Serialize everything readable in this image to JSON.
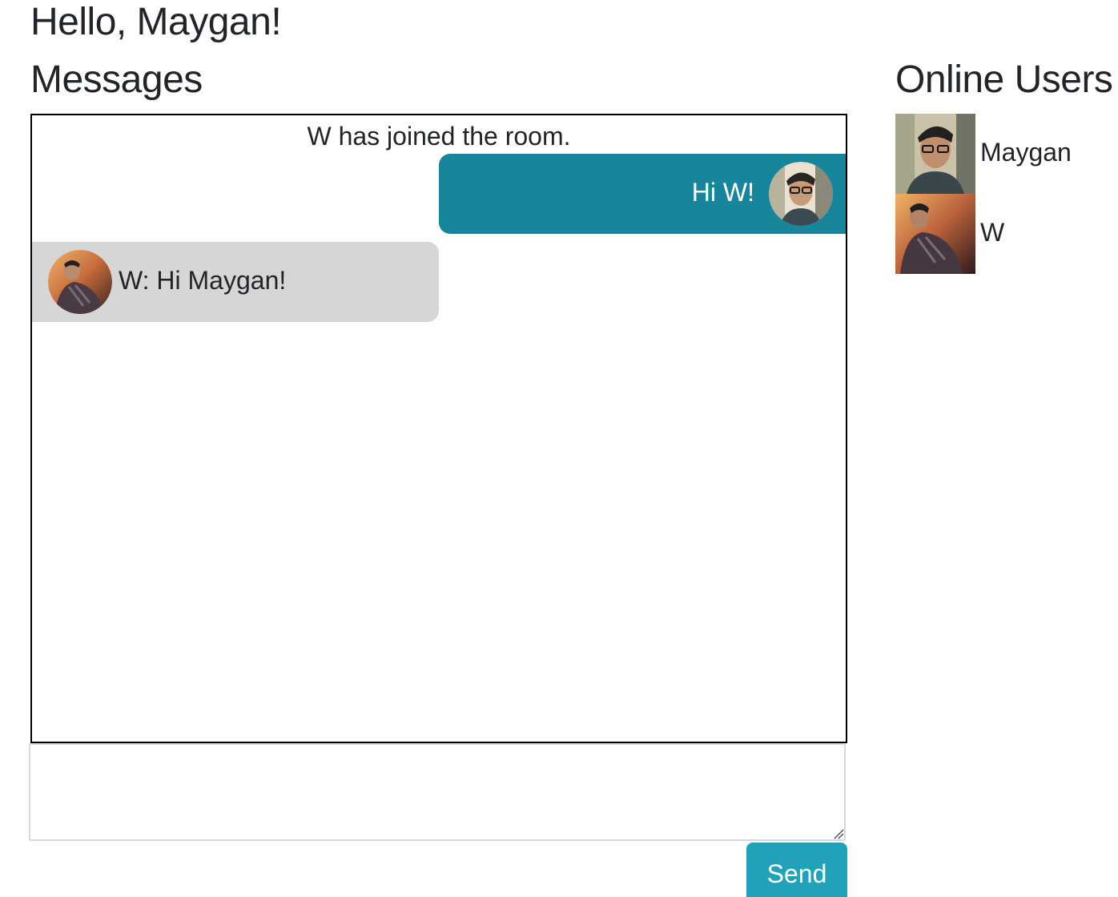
{
  "header": {
    "greeting": "Hello, Maygan!"
  },
  "messages": {
    "title": "Messages",
    "items": [
      {
        "kind": "system",
        "text": "W has joined the room."
      },
      {
        "kind": "outgoing",
        "text": "Hi W!",
        "avatar": "user-photo-maygan"
      },
      {
        "kind": "incoming",
        "text": "W: Hi Maygan!",
        "avatar": "user-photo-w"
      }
    ]
  },
  "composer": {
    "value": "",
    "placeholder": "",
    "send_label": "Send"
  },
  "online": {
    "title": "Online Users",
    "users": [
      {
        "name": "Maygan",
        "photo": "user-photo-maygan"
      },
      {
        "name": "W",
        "photo": "user-photo-w"
      }
    ]
  },
  "colors": {
    "outgoing_bubble": "#17869b",
    "incoming_bubble": "#d6d6d6",
    "send_button": "#22a2b8",
    "text": "#212529"
  }
}
